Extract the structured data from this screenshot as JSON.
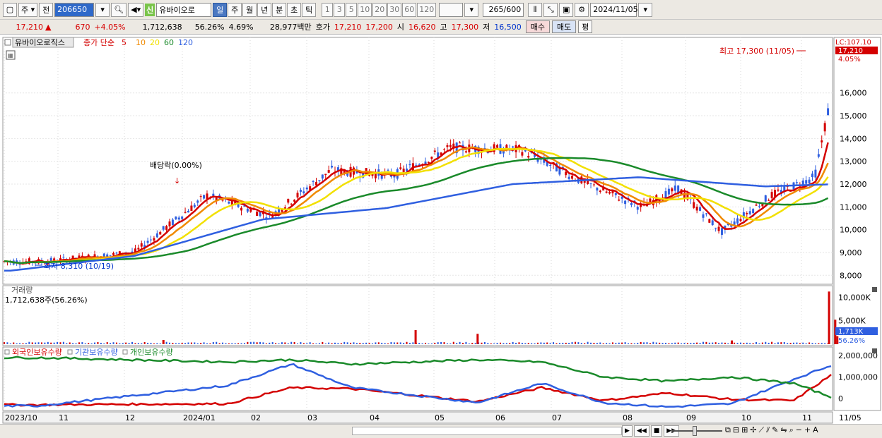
{
  "toolbar": {
    "period_type": "주",
    "prev_label": "전",
    "stock_code": "206650",
    "credit_badge": "신",
    "stock_name": "유바이오로",
    "timeframes": [
      "일",
      "주",
      "월",
      "년",
      "분",
      "초",
      "틱"
    ],
    "active_timeframe": "일",
    "intervals": [
      "1",
      "3",
      "5",
      "10",
      "20",
      "30",
      "60",
      "120"
    ],
    "bar_count": "265",
    "bar_total": "/600",
    "date": "2024/11/05"
  },
  "quote": {
    "price": "17,210",
    "change": "670",
    "change_pct": "+4.05%",
    "volume": "1,712,638",
    "volume_ratio": "56.26%",
    "turnover": "4.69%",
    "amount": "28,977백만",
    "hoga_label": "호가",
    "ask": "17,210",
    "bid": "17,200",
    "open_label": "시",
    "open": "16,620",
    "high_label": "고",
    "high": "17,300",
    "low_label": "저",
    "low": "16,500",
    "buy_label": "매수",
    "sell_label": "매도",
    "eval_label": "평"
  },
  "price_pane": {
    "title": "유바이오로직스",
    "legend_prefix": "종가 단순",
    "ma_periods": [
      "5",
      "10",
      "20",
      "60",
      "120"
    ],
    "ma_colors": [
      "#d40000",
      "#f08a00",
      "#f2e000",
      "#1a8a2a",
      "#2f5fe0"
    ],
    "lc_label": "LC:107.10",
    "last_price": "17,210",
    "last_pct": "4.05%",
    "high_annotation": "최고 17,300 (11/05)",
    "low_annotation": "최저 8,310 (10/19)",
    "dividend_annotation": "배당락(0.00%)",
    "y_ticks": [
      "16,000",
      "15,000",
      "14,000",
      "13,000",
      "12,000",
      "11,000",
      "10,000",
      "9,000",
      "8,000"
    ]
  },
  "volume_pane": {
    "title": "거래량",
    "value": "1,712,638주(56.26%)",
    "y_ticks": [
      "10,000K",
      "5,000K"
    ],
    "last_value": "1,713K",
    "last_pct": "56.26%"
  },
  "holdings_pane": {
    "series": [
      {
        "name": "외국인보유수량",
        "color": "#d40000"
      },
      {
        "name": "기관보유수량",
        "color": "#2f5fe0"
      },
      {
        "name": "개인보유수량",
        "color": "#1a8a2a"
      }
    ],
    "y_ticks": [
      "2,000,000",
      "1,000,000",
      "0"
    ]
  },
  "x_axis": {
    "labels": [
      "2023/10",
      "11",
      "12",
      "2024/01",
      "02",
      "03",
      "04",
      "05",
      "06",
      "07",
      "08",
      "09",
      "10",
      "11",
      "11/05"
    ]
  },
  "chart_data": [
    {
      "type": "line",
      "title": "유바이오로직스",
      "ylim": [
        7700,
        17600
      ],
      "series": [
        {
          "name": "종가",
          "x": [
            "2023/10/19",
            "2023/12/01",
            "2024/01/05",
            "2024/02/05",
            "2024/03/05",
            "2024/04/05",
            "2024/05/02",
            "2024/06/05",
            "2024/07/05",
            "2024/08/02",
            "2024/08/20",
            "2024/09/10",
            "2024/10/04",
            "2024/10/25",
            "2024/11/05"
          ],
          "values": [
            8600,
            9000,
            11500,
            10600,
            12600,
            12400,
            13600,
            13500,
            12100,
            11000,
            11800,
            9900,
            11500,
            12300,
            17210
          ]
        },
        {
          "name": "120",
          "x": [
            "2023/10/02",
            "2023/12/01",
            "2024/02/01",
            "2024/04/01",
            "2024/06/01",
            "2024/08/01",
            "2024/10/01",
            "2024/11/05"
          ],
          "values": [
            8200,
            8850,
            10450,
            10950,
            12000,
            12300,
            11900,
            12000
          ]
        }
      ]
    },
    {
      "type": "bar",
      "title": "거래량",
      "ylim": [
        0,
        12000
      ],
      "categories": [
        "2023/12",
        "2024/04",
        "2024/05",
        "2024/09",
        "2024/11/01",
        "2024/11/04",
        "2024/11/05"
      ],
      "values": [
        900,
        3000,
        2200,
        800,
        11200,
        5200,
        1713
      ]
    },
    {
      "type": "line",
      "ylim": [
        -500000,
        2200000
      ],
      "series": [
        {
          "name": "외국인보유수량",
          "x": [
            "2023/10",
            "2024/01",
            "2024/02",
            "2024/03",
            "2024/05",
            "2024/06",
            "2024/07",
            "2024/08",
            "2024/09",
            "2024/10",
            "2024/11"
          ],
          "values": [
            -300000,
            -250000,
            500000,
            450000,
            -150000,
            500000,
            -100000,
            250000,
            -50000,
            -100000,
            1950000
          ]
        },
        {
          "name": "기관보유수량",
          "x": [
            "2023/10",
            "2024/01",
            "2024/02",
            "2024/03",
            "2024/05",
            "2024/06",
            "2024/07",
            "2024/08",
            "2024/09",
            "2024/10",
            "2024/11"
          ],
          "values": [
            -350000,
            600000,
            1600000,
            500000,
            -200000,
            700000,
            -200000,
            -400000,
            -250000,
            900000,
            2000000
          ]
        },
        {
          "name": "개인보유수량",
          "x": [
            "2023/10",
            "2024/01",
            "2024/02",
            "2024/03",
            "2024/05",
            "2024/06",
            "2024/07",
            "2024/08",
            "2024/09",
            "2024/10",
            "2024/11"
          ],
          "values": [
            1900000,
            1700000,
            1800000,
            1600000,
            1800000,
            1700000,
            1000000,
            800000,
            1000000,
            700000,
            -400000
          ]
        }
      ]
    }
  ]
}
